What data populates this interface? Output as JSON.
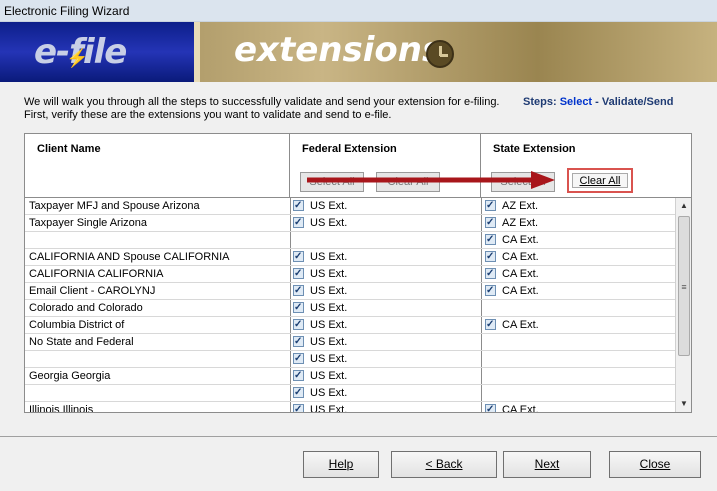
{
  "window": {
    "title": "Electronic Filing Wizard"
  },
  "banner": {
    "logo": "e-file",
    "bolt": "⚡",
    "heading": "extensions"
  },
  "intro": {
    "line1": "We will walk you through all the steps to successfully validate and send your extension for e-filing.",
    "line2": "First, verify these are the extensions you want to validate and send to e-file."
  },
  "steps": {
    "label": "Steps:",
    "current": "Select",
    "rest": "- Validate/Send"
  },
  "table": {
    "headers": {
      "client": "Client Name",
      "federal": "Federal Extension",
      "state": "State Extension"
    },
    "federal_buttons": {
      "select_all": "Select All",
      "clear_all": "Clear All"
    },
    "state_buttons": {
      "select_all": "Select All",
      "clear_all": "Clear All"
    },
    "rows": [
      {
        "name": "Taxpayer MFJ and Spouse Arizona",
        "fed": "US Ext.",
        "state": "AZ Ext."
      },
      {
        "name": "Taxpayer Single Arizona",
        "fed": "US Ext.",
        "state": "AZ Ext."
      },
      {
        "name": "",
        "fed": "",
        "state": "CA Ext."
      },
      {
        "name": "CALIFORNIA AND Spouse CALIFORNIA",
        "fed": "US Ext.",
        "state": "CA Ext."
      },
      {
        "name": "CALIFORNIA CALIFORNIA",
        "fed": "US Ext.",
        "state": "CA Ext."
      },
      {
        "name": "Email Client - CAROLYNJ",
        "fed": "US Ext.",
        "state": "CA Ext."
      },
      {
        "name": "Colorado and  Colorado",
        "fed": "US Ext.",
        "state": ""
      },
      {
        "name": "Columbia District of",
        "fed": "US Ext.",
        "state": "CA Ext."
      },
      {
        "name": "No State and  Federal",
        "fed": "US Ext.",
        "state": ""
      },
      {
        "name": "",
        "fed": "US Ext.",
        "state": ""
      },
      {
        "name": "Georgia Georgia",
        "fed": "US Ext.",
        "state": ""
      },
      {
        "name": "",
        "fed": "US Ext.",
        "state": ""
      },
      {
        "name": "Illinois Illinois",
        "fed": "US Ext.",
        "state": "CA Ext."
      }
    ]
  },
  "highlight": {
    "label": "Clear All",
    "border_color": "#d9534f",
    "arrow_color": "#a8161b"
  },
  "footer": {
    "help": "Help",
    "back": "< Back",
    "next": "Next",
    "close": "Close"
  }
}
